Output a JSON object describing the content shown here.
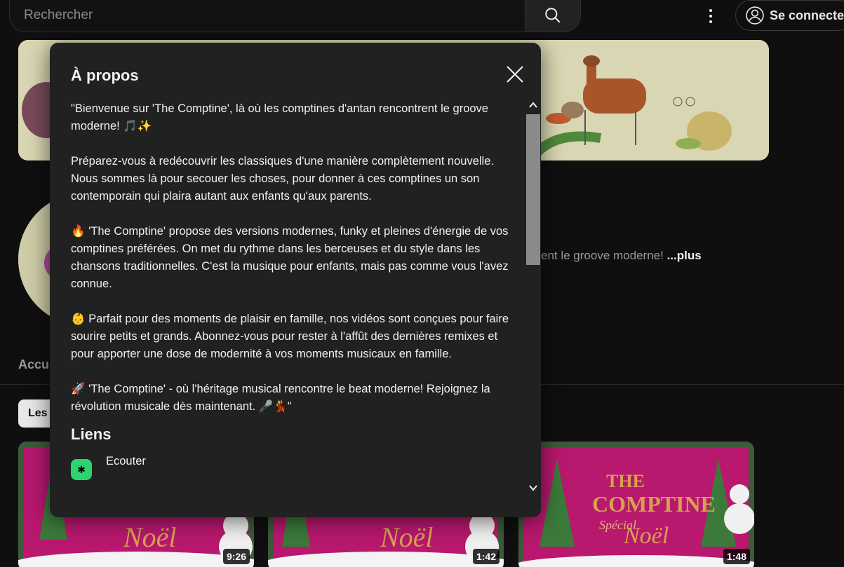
{
  "search": {
    "placeholder": "Rechercher"
  },
  "header": {
    "signin_label": "Se connecter"
  },
  "channel": {
    "description_tail": "ent le groove moderne! ",
    "more_label": "...plus",
    "tab_partial": "Accu",
    "chip_partial": "Les"
  },
  "videos": [
    {
      "duration": "9:26"
    },
    {
      "duration": "1:42"
    },
    {
      "duration": "1:48"
    }
  ],
  "thumbnail_logo": {
    "line1": "THE",
    "line2": "COMPTINE",
    "line3": "Spécial",
    "line4": "Noël"
  },
  "modal": {
    "title": "À propos",
    "about": "\"Bienvenue sur 'The Comptine', là où les comptines d'antan rencontrent le groove moderne! 🎵✨\n\nPréparez-vous à redécouvrir les classiques d'une manière complètement nouvelle. Nous sommes là pour secouer les choses, pour donner à ces comptines un son contemporain qui plaira autant aux enfants qu'aux parents.\n\n🔥 'The Comptine' propose des versions modernes, funky et pleines d'énergie de vos comptines préférées. On met du rythme dans les berceuses et du style dans les chansons traditionnelles. C'est la musique pour enfants, mais pas comme vous l'avez connue.\n\n👶 Parfait pour des moments de plaisir en famille, nos vidéos sont conçues pour faire sourire petits et grands. Abonnez-vous pour rester à l'affût des dernières remixes et pour apporter une dose de modernité à vos moments musicaux en famille.\n\n🚀 'The Comptine' - où l'héritage musical rencontre le beat moderne! Rejoignez la révolution musicale dès maintenant. 🎤💃\"",
    "links_title": "Liens",
    "links": [
      {
        "label": "Ecouter",
        "icon": "asterisk-icon"
      }
    ]
  },
  "colors": {
    "modal_bg": "#212121",
    "page_bg": "#0f0f0f",
    "link_icon": "#2dd36f",
    "thumb_pink": "#b8186e"
  }
}
